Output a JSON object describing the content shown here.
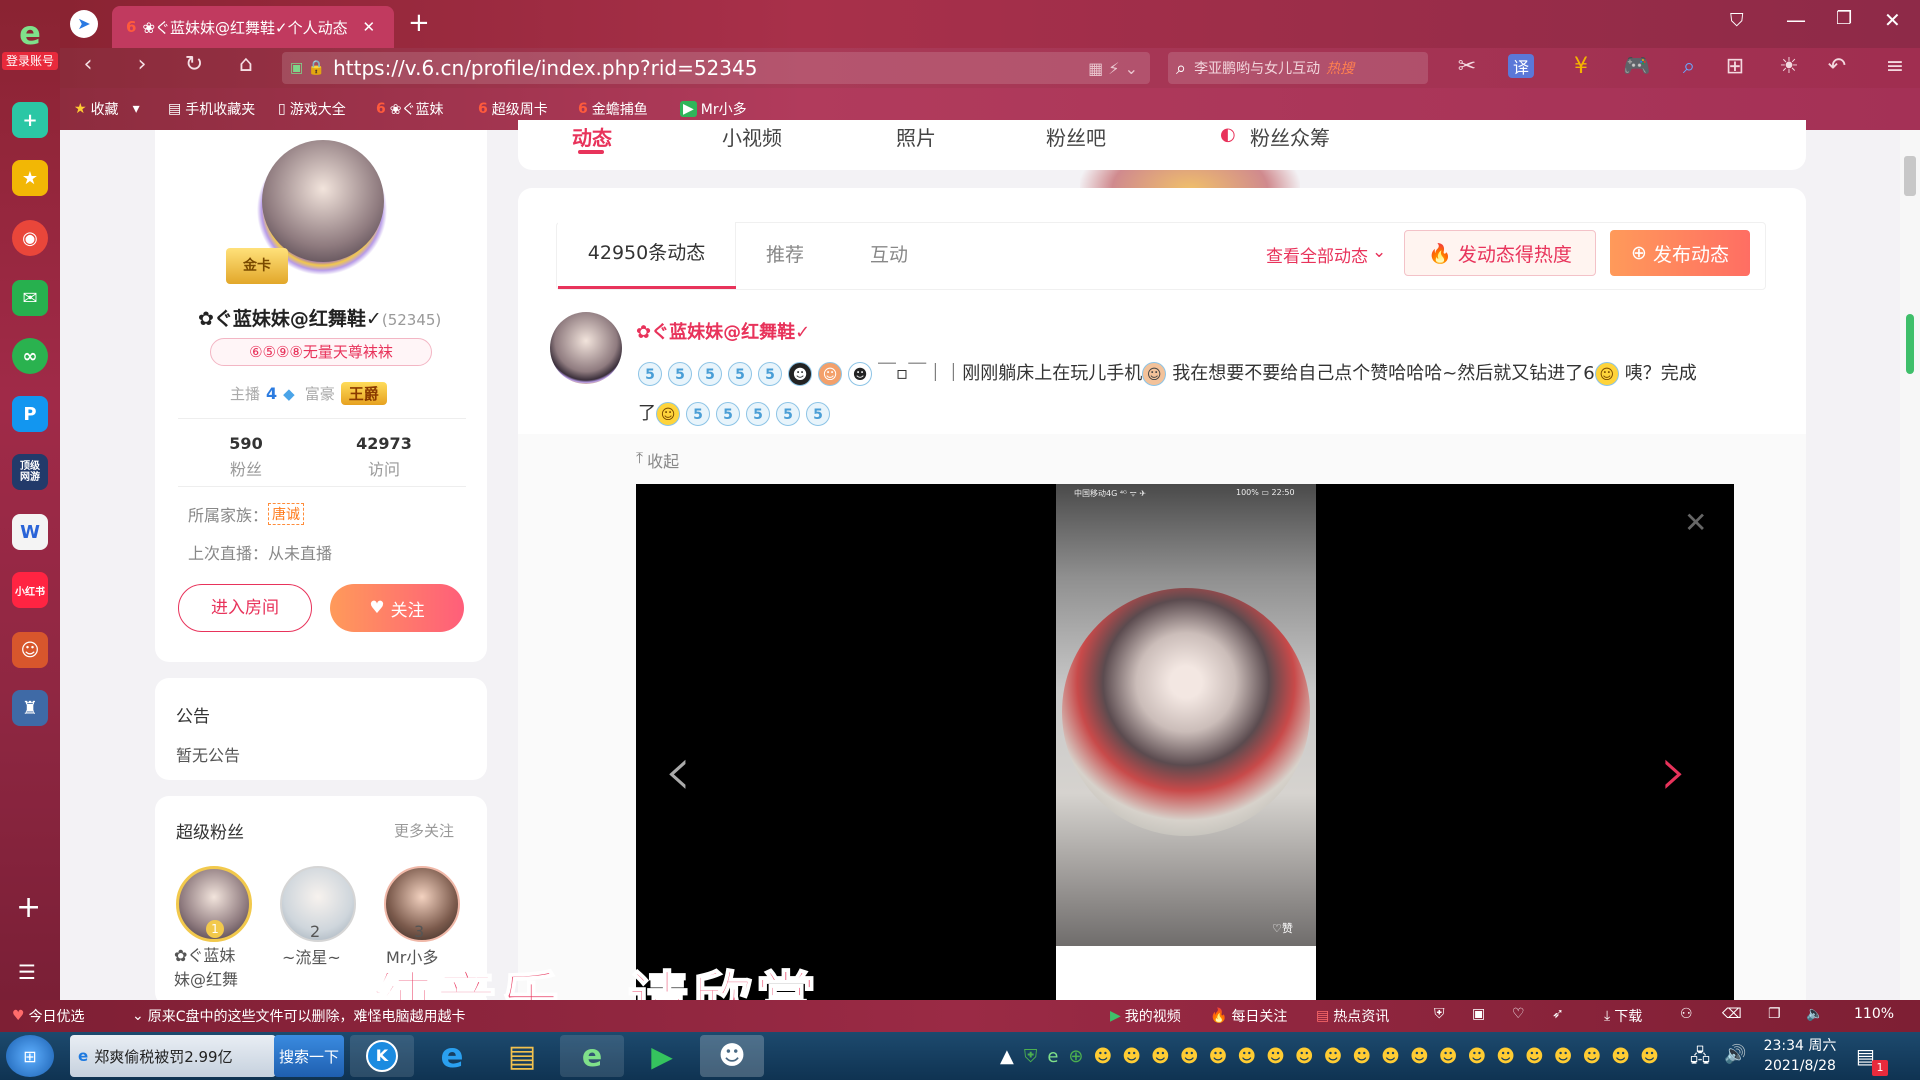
{
  "browser": {
    "login_badge": "登录账号",
    "tab_title": "❀ぐ蓝妹妹@红舞鞋✓个人动态",
    "url": "https://v.6.cn/profile/index.php?rid=52345",
    "search_text": "李亚鹏哟与女儿互动",
    "search_hot": "热搜",
    "translate_label": "译"
  },
  "favorites": [
    {
      "label": "收藏"
    },
    {
      "label": "手机收藏夹"
    },
    {
      "label": "游戏大全"
    },
    {
      "label": "❀ぐ蓝妹"
    },
    {
      "label": "超级周卡"
    },
    {
      "label": "金蟾捕鱼"
    },
    {
      "label": "Mr小多"
    }
  ],
  "rail": {
    "wps_label": "W",
    "game_label": "顶级\n网游",
    "xhs_label": "小红书"
  },
  "profile": {
    "nav_tabs": [
      "动态",
      "小视频",
      "照片",
      "粉丝吧",
      "粉丝众筹"
    ],
    "badge_gold": "金卡",
    "name": "✿ぐ蓝妹妹@红舞鞋✓",
    "rid": "(52345)",
    "title_badge": "⑥⑤⑨⑧无量天尊袜袜",
    "anchor_label": "主播",
    "anchor_level": "4",
    "rich_label": "富豪",
    "rich_badge": "王爵",
    "fans_count": "590",
    "fans_label": "粉丝",
    "visits_count": "42973",
    "visits_label": "访问",
    "family_label": "所属家族：",
    "family_value": "唐诚",
    "last_live": "上次直播：从未直播",
    "enter_room": "进入房间",
    "follow": "关注"
  },
  "notice": {
    "title": "公告",
    "body": "暂无公告"
  },
  "super_fans": {
    "title": "超级粉丝",
    "more": "更多关注",
    "fans": [
      {
        "rank": "1",
        "name": "✿ぐ蓝妹\n妹@红舞"
      },
      {
        "rank": "2",
        "name": "~流星~"
      },
      {
        "rank": "3",
        "name": "Mr小多"
      }
    ]
  },
  "feed": {
    "tabs": [
      "42950条动态",
      "推荐",
      "互动"
    ],
    "view_all": "查看全部动态",
    "hot_btn": "发动态得热度",
    "post_btn": "发布动态",
    "author": "✿ぐ蓝妹妹@红舞鞋✓",
    "post_text_1": "￣▫￣｜｜刚刚躺床上在玩儿手机",
    "post_text_2": "我在想要不要给自己点个赞哈哈哈~然后就又钻进了6",
    "post_text_3": "咦？完成",
    "post_text_4": "了",
    "collapse": "收起",
    "phone_status_left": "中国移动4G ⁴ᴳ ᯤ ✈",
    "phone_status_right": "100% ▭ 22:50",
    "phone_like": "♡赞",
    "caption": "纯音乐，请欣赏"
  },
  "statusbar": {
    "today": "今日优选",
    "news": "原来C盘中的这些文件可以删除，难怪电脑越用越卡",
    "my_video": "我的视频",
    "daily": "每日关注",
    "hot_news": "热点资讯",
    "download": "下载",
    "zoom": "110%"
  },
  "taskbar": {
    "ie_tab": "郑爽偷税被罚2.99亿",
    "search_btn": "搜索一下",
    "time": "23:34 周六",
    "date": "2021/8/28",
    "notif_count": "1"
  },
  "colors": {
    "accent": "#e8335b",
    "orange": "#ff7a45",
    "follow_grad_start": "#ff9a5a",
    "follow_grad_end": "#ff5e7a"
  }
}
